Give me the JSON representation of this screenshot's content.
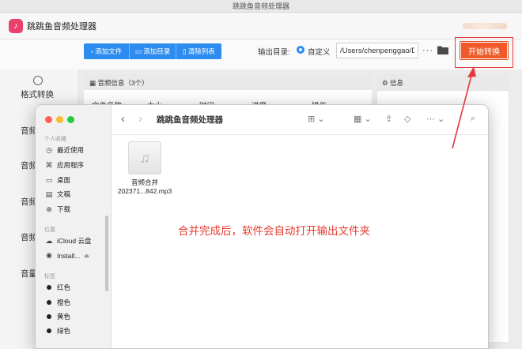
{
  "app": {
    "window_title": "跳跳鱼音频处理器",
    "name": "跳跳鱼音频处理器",
    "logo_glyph": "♪",
    "accent": "#2d8cf0",
    "start_color": "#f05a2a"
  },
  "toolbar": {
    "add_file": "添加文件",
    "add_folder": "添加目录",
    "clear_list": "清除列表",
    "output_label": "输出目录:",
    "radio_label": "自定义",
    "path_value": "/Users/chenpenggao/D",
    "more_label": "···",
    "start_label": "开始转换"
  },
  "sidebar": {
    "items": [
      "格式转换",
      "音频",
      "音频",
      "音频",
      "音频",
      "音量"
    ]
  },
  "panel": {
    "audio_info": "音频信息（3个）",
    "info": "信息",
    "columns": [
      "文件名称",
      "大小",
      "时间",
      "进度",
      "操作"
    ]
  },
  "finder": {
    "title": "跳跳鱼音频处理器",
    "sections": {
      "personal": "个人收藏",
      "locations": "位置",
      "tags": "标签"
    },
    "favorites": [
      {
        "icon": "clock-icon",
        "glyph": "◷",
        "label": "最近使用"
      },
      {
        "icon": "apps-icon",
        "glyph": "⌘",
        "label": "应用程序"
      },
      {
        "icon": "desktop-icon",
        "glyph": "▭",
        "label": "桌面"
      },
      {
        "icon": "document-icon",
        "glyph": "▤",
        "label": "文稿"
      },
      {
        "icon": "download-icon",
        "glyph": "⊕",
        "label": "下载"
      }
    ],
    "locations": [
      {
        "icon": "cloud-icon",
        "glyph": "☁",
        "label": "iCloud 云盘"
      },
      {
        "icon": "disk-icon",
        "glyph": "◉",
        "label": "Install..."
      }
    ],
    "tags": [
      {
        "label": "红色"
      },
      {
        "label": "橙色"
      },
      {
        "label": "黄色"
      },
      {
        "label": "绿色"
      }
    ],
    "file": {
      "name_line1": "音频合并",
      "name_line2": "202371...842.mp3"
    }
  },
  "annotation": "合并完成后，软件会自动打开输出文件夹"
}
